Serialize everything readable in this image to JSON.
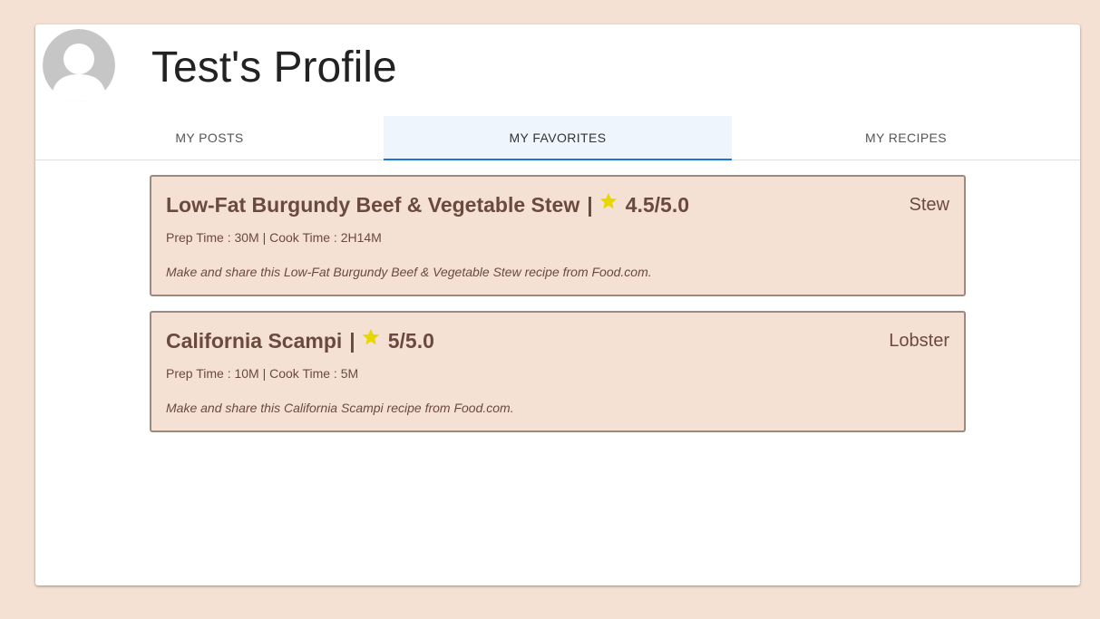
{
  "profile": {
    "title": "Test's Profile"
  },
  "tabs": [
    {
      "label": "MY POSTS",
      "active": false
    },
    {
      "label": "MY FAVORITES",
      "active": true
    },
    {
      "label": "MY RECIPES",
      "active": false
    }
  ],
  "colors": {
    "page_background": "#f5e1d4",
    "card_background": "#ffffff",
    "recipe_background": "#f5e1d4",
    "recipe_text": "#6b4a3e",
    "recipe_border": "#9e8880",
    "star": "#e6d700",
    "tab_active_background": "#eef5fd",
    "tab_indicator": "#1976d2",
    "avatar": "#c6c6c6"
  },
  "recipes": [
    {
      "name": "Low-Fat Burgundy Beef & Vegetable Stew",
      "separator": "|",
      "rating": "4.5/5.0",
      "category": "Stew",
      "times": "Prep Time : 30M | Cook Time : 2H14M",
      "description": "Make and share this Low-Fat Burgundy Beef & Vegetable Stew recipe from Food.com."
    },
    {
      "name": "California Scampi",
      "separator": "|",
      "rating": "5/5.0",
      "category": "Lobster",
      "times": "Prep Time : 10M | Cook Time : 5M",
      "description": "Make and share this California Scampi recipe from Food.com."
    }
  ]
}
